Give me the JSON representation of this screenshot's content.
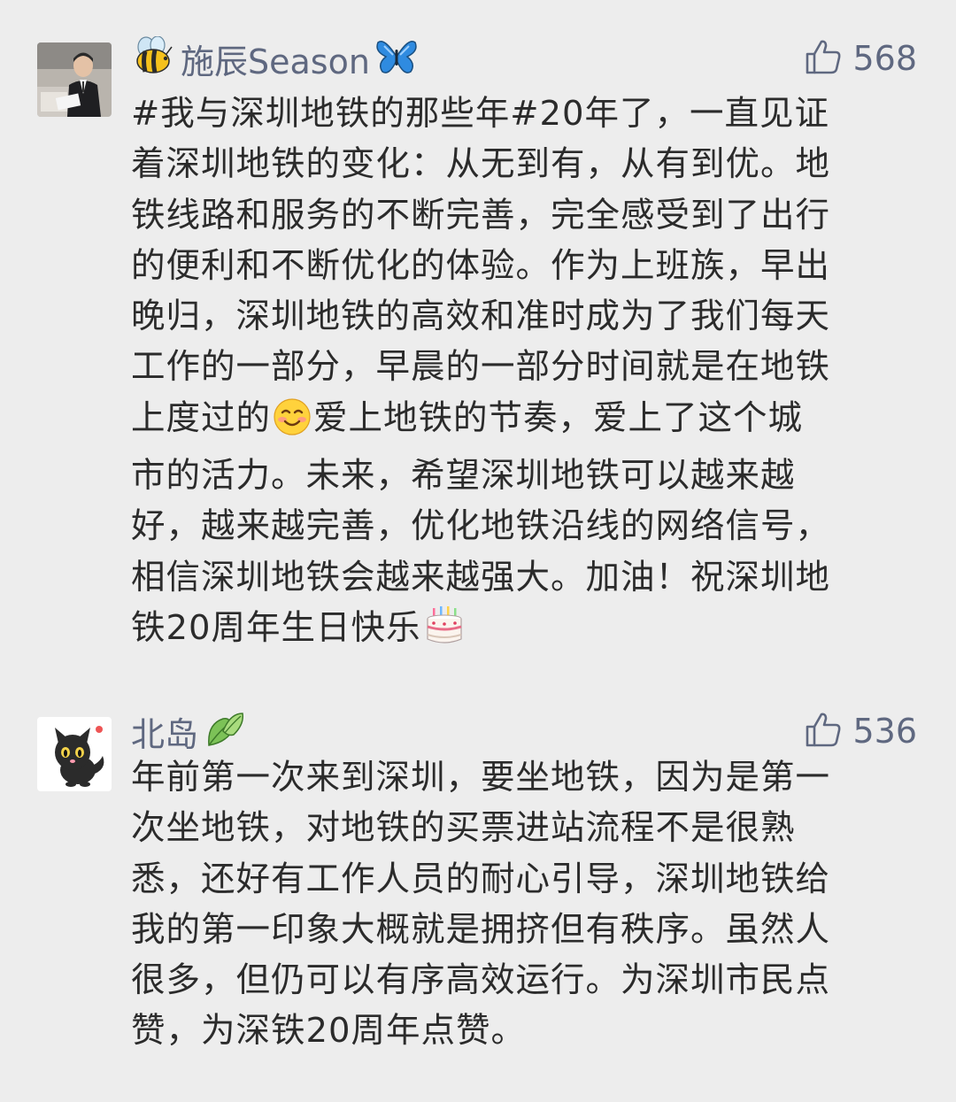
{
  "comments": [
    {
      "user": "施辰Season",
      "likes": "568",
      "lines": [
        "#我与深圳地铁的那些年#20年了，一直见证",
        "着深圳地铁的变化：从无到有，从有到优。地",
        "铁线路和服务的不断完善，完全感受到了出行",
        "的便利和不断优化的体验。作为上班族，早出",
        "晚归，深圳地铁的高效和准时成为了我们每天",
        "工作的一部分，早晨的一部分时间就是在地铁",
        "上度过的",
        "爱上地铁的节奏，爱上了这个城",
        "市的活力。未来，希望深圳地铁可以越来越",
        "好，越来越完善，优化地铁沿线的网络信号，",
        "相信深圳地铁会越来越强大。加油！祝深圳地",
        "铁20周年生日快乐"
      ],
      "icons": [
        "bee-icon",
        "butterfly-icon",
        "smile-emoji-icon",
        "birthday-cake-icon",
        "thumbs-up-icon"
      ]
    },
    {
      "user": "北岛",
      "likes": "536",
      "lines": [
        "年前第一次来到深圳，要坐地铁，因为是第一",
        "次坐地铁，对地铁的买票进站流程不是很熟",
        "悉，还好有工作人员的耐心引导，深圳地铁给",
        "我的第一印象大概就是拥挤但有秩序。虽然人",
        "很多，但仍可以有序高效运行。为深圳市民点",
        "赞，为深铁20周年点赞。"
      ],
      "icons": [
        "leaf-icon",
        "black-cat-icon",
        "thumbs-up-icon"
      ]
    }
  ],
  "colors": {
    "background": "#ededed",
    "name": "#5f6880",
    "text": "#2b2b2b"
  }
}
